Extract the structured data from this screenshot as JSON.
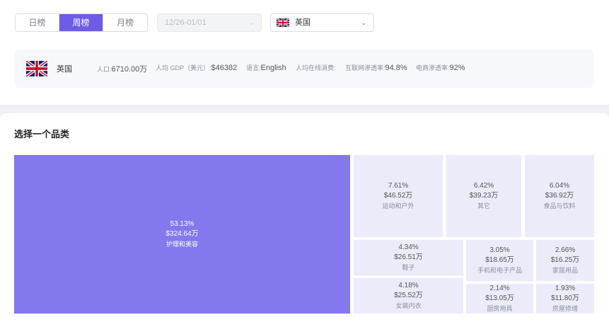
{
  "period_tabs": [
    {
      "label": "日榜",
      "active": false
    },
    {
      "label": "周榜",
      "active": true
    },
    {
      "label": "月榜",
      "active": false
    }
  ],
  "date_range": {
    "value": "12/26-01/01"
  },
  "country_select": {
    "value": "英国",
    "icon": "uk-flag-icon"
  },
  "country_info": {
    "name": "英国",
    "population_label": "人口:",
    "population_value": "6710.00万",
    "gdp_label": "人均 GDP（美元）:",
    "gdp_value": "$46382",
    "language_label": "语言:",
    "language_value": "English",
    "spend_label": "人均在线消费:",
    "spend_value": "",
    "internet_label": "互联网渗透率:",
    "internet_value": "94.8%",
    "ecommerce_label": "电商渗透率:",
    "ecommerce_value": "92%"
  },
  "section_title": "选择一个品类",
  "categories": [
    {
      "pct": "53.13%",
      "amount": "$324.64万",
      "name": "护理和美容"
    },
    {
      "pct": "7.61%",
      "amount": "$46.52万",
      "name": "运动和户外"
    },
    {
      "pct": "6.42%",
      "amount": "$39.23万",
      "name": "其它"
    },
    {
      "pct": "6.04%",
      "amount": "$36.92万",
      "name": "食品与饮料"
    },
    {
      "pct": "4.34%",
      "amount": "$26.51万",
      "name": "鞋子"
    },
    {
      "pct": "3.05%",
      "amount": "$18.65万",
      "name": "手机和电子产品"
    },
    {
      "pct": "2.66%",
      "amount": "$16.25万",
      "name": "家居用品"
    },
    {
      "pct": "4.18%",
      "amount": "$25.52万",
      "name": "女装内衣"
    },
    {
      "pct": "2.14%",
      "amount": "$13.05万",
      "name": "厨房用具"
    },
    {
      "pct": "1.93%",
      "amount": "$11.80万",
      "name": "房屋修缮"
    }
  ],
  "colors": {
    "accent": "#6c5ce7",
    "treemap_big": "#8378ee",
    "treemap_small": "#ebebfa"
  }
}
